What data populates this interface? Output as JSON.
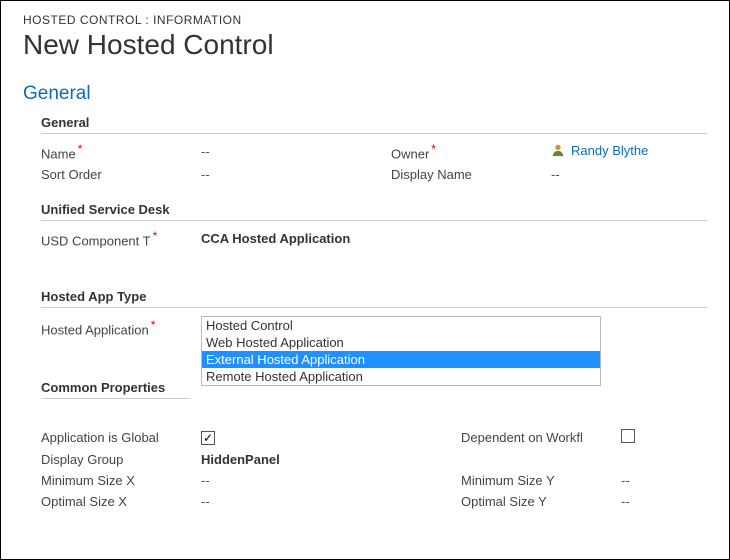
{
  "breadcrumb": "HOSTED CONTROL : INFORMATION",
  "page_title": "New Hosted Control",
  "section_nav": "General",
  "groups": {
    "general": {
      "header": "General",
      "name_label": "Name",
      "name_value": "--",
      "owner_label": "Owner",
      "owner_value": "Randy Blythe",
      "sort_order_label": "Sort Order",
      "sort_order_value": "--",
      "display_name_label": "Display Name",
      "display_name_value": "--"
    },
    "usd": {
      "header": "Unified Service Desk",
      "usd_component_label": "USD Component T",
      "usd_component_value": "CCA Hosted Application"
    },
    "hosted_app_type": {
      "header": "Hosted App Type",
      "hosted_app_label": "Hosted Application",
      "options": [
        "Hosted Control",
        "Web Hosted Application",
        "External Hosted Application",
        "Remote Hosted Application"
      ],
      "selected_index": 2
    },
    "common": {
      "header": "Common Properties",
      "app_is_global_label": "Application is Global",
      "app_is_global_checked": true,
      "dependent_workflow_label": "Dependent on Workfl",
      "dependent_workflow_checked": false,
      "display_group_label": "Display Group",
      "display_group_value": "HiddenPanel",
      "min_size_x_label": "Minimum Size X",
      "min_size_x_value": "--",
      "min_size_y_label": "Minimum Size Y",
      "min_size_y_value": "--",
      "opt_size_x_label": "Optimal Size X",
      "opt_size_x_value": "--",
      "opt_size_y_label": "Optimal Size Y",
      "opt_size_y_value": "--"
    }
  }
}
